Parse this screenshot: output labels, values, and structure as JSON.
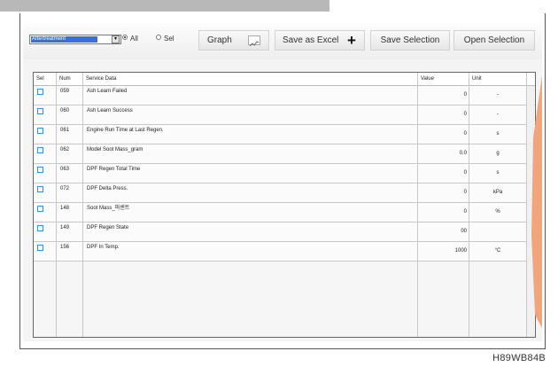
{
  "toolbar": {
    "filter_value": "Aftertreatment",
    "radio_all": "All",
    "radio_sel": "Sel",
    "graph_label": "Graph",
    "save_excel_label": "Save as Excel",
    "save_selection_label": "Save Selection",
    "open_selection_label": "Open Selection"
  },
  "table": {
    "headers": [
      "Sel",
      "Num",
      "Service Data",
      "Value",
      "Unit"
    ],
    "rows": [
      {
        "num": "059",
        "name": "Ash Learn Failed",
        "value": "0",
        "unit": "-"
      },
      {
        "num": "060",
        "name": "Ash Learn Success",
        "value": "0",
        "unit": "-"
      },
      {
        "num": "061",
        "name": "Engine Run Time at Last Regen.",
        "value": "0",
        "unit": "s"
      },
      {
        "num": "062",
        "name": "Model Soot Mass_gram",
        "value": "0.0",
        "unit": "g"
      },
      {
        "num": "063",
        "name": "DPF Regen Total Time",
        "value": "0",
        "unit": "s"
      },
      {
        "num": "072",
        "name": "DPF Delta Press.",
        "value": "0",
        "unit": "kPa"
      },
      {
        "num": "148",
        "name": "Soot Mass_퍼센트",
        "value": "0",
        "unit": "%"
      },
      {
        "num": "149",
        "name": "DPF Regen State",
        "value": "00",
        "unit": ""
      },
      {
        "num": "156",
        "name": "DPF In Temp.",
        "value": "1000",
        "unit": "°C"
      }
    ]
  },
  "figure_code": "H89WB84B",
  "colors": {
    "accent_orange": "#f2a57a",
    "checkbox_border": "#3b8ed4",
    "selection_blue": "#3a6fd8"
  }
}
